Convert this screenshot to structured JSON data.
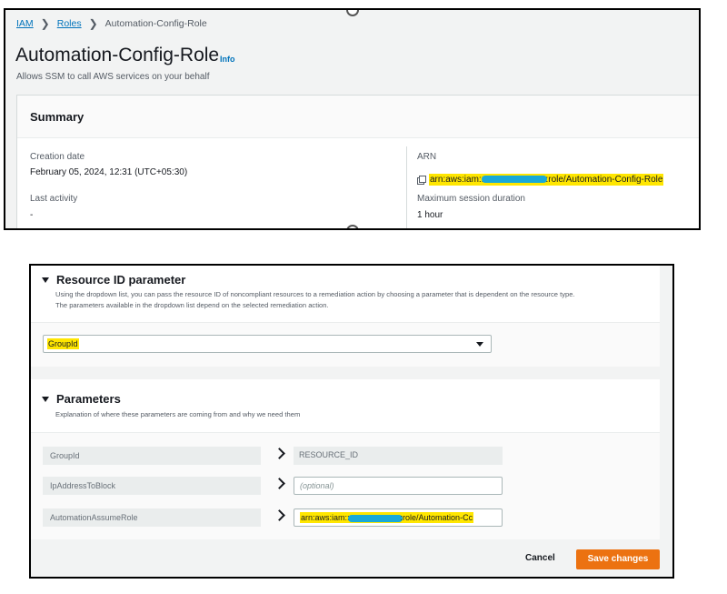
{
  "breadcrumb": {
    "items": [
      "IAM",
      "Roles"
    ],
    "current": "Automation-Config-Role"
  },
  "role": {
    "title": "Automation-Config-Role",
    "info_label": "Info",
    "description": "Allows SSM to call AWS services on your behalf"
  },
  "summary": {
    "title": "Summary",
    "creation_label": "Creation date",
    "creation_value": "February 05, 2024, 12:31 (UTC+05:30)",
    "activity_label": "Last activity",
    "activity_value": "-",
    "arn_label": "ARN",
    "arn_prefix": "arn:aws:iam::",
    "arn_suffix": ":role/Automation-Config-Role",
    "session_label": "Maximum session duration",
    "session_value": "1 hour"
  },
  "resource_section": {
    "title": "Resource ID parameter",
    "description_line1": "Using the dropdown list, you can pass the resource ID of noncompliant resources to a remediation action by choosing a parameter that is dependent on the resource type.",
    "description_line2": "The parameters available in the dropdown list depend on the selected remediation action.",
    "selected_value": "GroupId"
  },
  "parameters_section": {
    "title": "Parameters",
    "description": "Explanation of where these parameters are coming from and why we need them",
    "rows": [
      {
        "name": "GroupId",
        "value": "RESOURCE_ID"
      },
      {
        "name": "IpAddressToBlock",
        "placeholder": "(optional)"
      },
      {
        "name": "AutomationAssumeRole",
        "value_prefix": "arn:aws:iam::",
        "value_suffix": ":role/Automation-Cc"
      }
    ]
  },
  "actions": {
    "cancel": "Cancel",
    "save": "Save changes"
  },
  "colors": {
    "link": "#0073bb",
    "highlight": "#ffe600",
    "redaction": "#19a9d8",
    "primary_button": "#ec7211"
  },
  "icons": [
    "copy-icon",
    "caret-down-icon",
    "chevron-right-icon",
    "triangle-down-icon"
  ]
}
